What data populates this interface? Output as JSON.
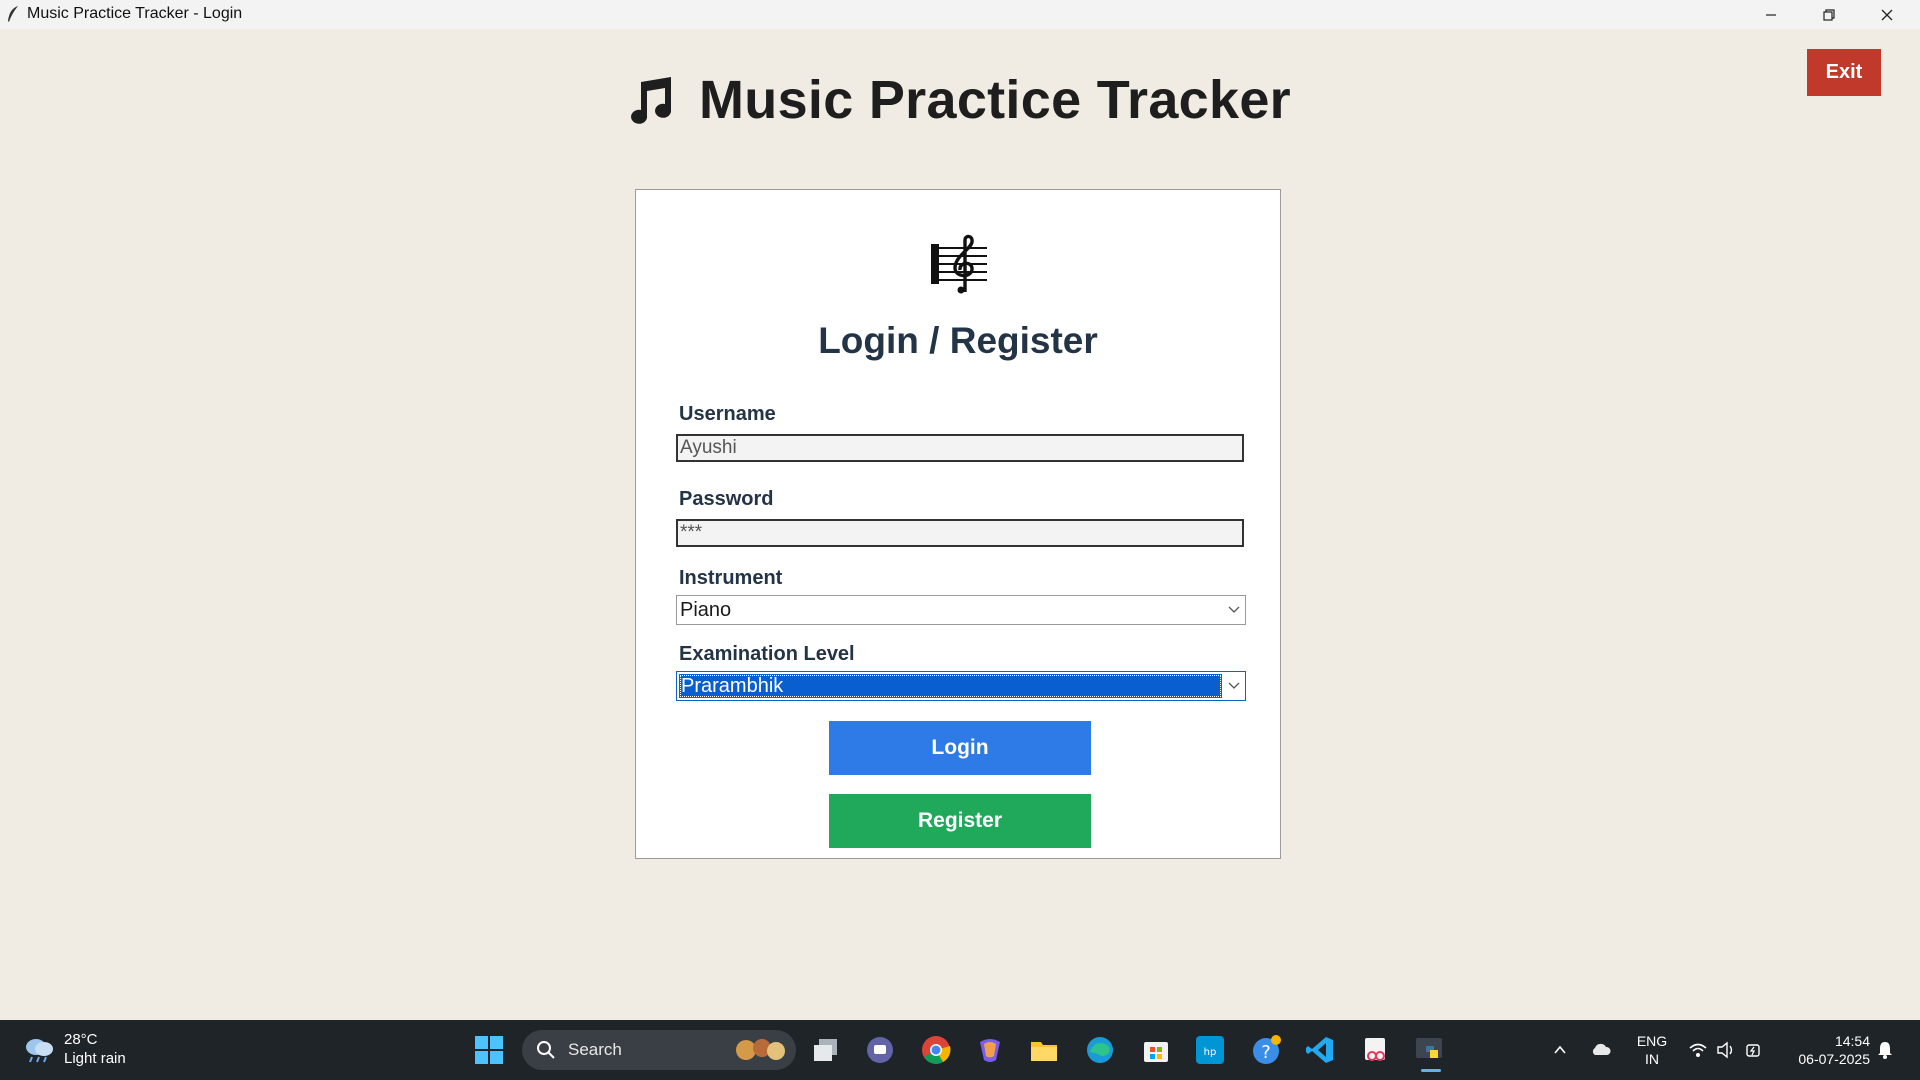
{
  "window": {
    "title": "Music Practice Tracker - Login"
  },
  "header": {
    "title": "Music Practice Tracker",
    "exit_label": "Exit"
  },
  "form": {
    "title": "Login / Register",
    "username_label": "Username",
    "username_value": "Ayushi",
    "password_label": "Password",
    "password_value": "***",
    "instrument_label": "Instrument",
    "instrument_value": "Piano",
    "level_label": "Examination Level",
    "level_value": "Prarambhik",
    "login_label": "Login",
    "register_label": "Register"
  },
  "taskbar": {
    "weather_temp": "28°C",
    "weather_desc": "Light rain",
    "search_label": "Search",
    "lang_top": "ENG",
    "lang_bottom": "IN",
    "time": "14:54",
    "date": "06-07-2025"
  },
  "colors": {
    "background": "#f0ebe3",
    "exit": "#c0392b",
    "login": "#2e7be8",
    "register": "#21a95b",
    "title_text": "#243447",
    "selection": "#0a5fd0"
  },
  "icons": {
    "app": "feather-icon",
    "header": "music-note-icon",
    "card": "treble-clef-icon"
  }
}
